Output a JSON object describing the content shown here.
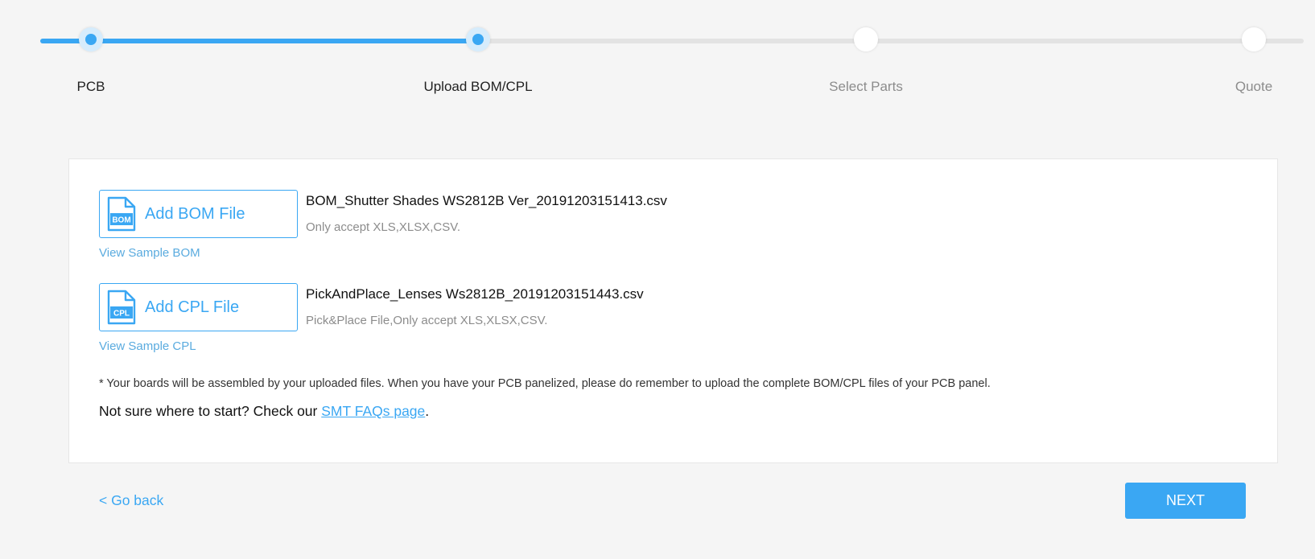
{
  "stepper": {
    "steps": [
      {
        "label": "PCB",
        "status": "done"
      },
      {
        "label": "Upload BOM/CPL",
        "status": "current"
      },
      {
        "label": "Select Parts",
        "status": "pending"
      },
      {
        "label": "Quote",
        "status": "pending"
      }
    ]
  },
  "bom": {
    "button_label": "Add BOM File",
    "icon_text": "BOM",
    "file_name": "BOM_Shutter Shades WS2812B Ver_20191203151413.csv",
    "hint": "Only accept XLS,XLSX,CSV.",
    "sample_link": "View Sample BOM"
  },
  "cpl": {
    "button_label": "Add CPL File",
    "icon_text": "CPL",
    "file_name": "PickAndPlace_Lenses Ws2812B_20191203151443.csv",
    "hint": "Pick&Place File,Only accept XLS,XLSX,CSV.",
    "sample_link": "View Sample CPL"
  },
  "note": "* Your boards will be assembled by your uploaded files. When you have your PCB panelized, please do remember to upload the complete BOM/CPL files of your PCB panel.",
  "help": {
    "prefix": "Not sure where to start? Check our ",
    "link": "SMT FAQs page",
    "suffix": "."
  },
  "footer": {
    "back_label": "< Go back",
    "next_label": "NEXT"
  },
  "colors": {
    "accent": "#3aa7f3",
    "track": "#e3e3e3",
    "muted_text": "#8c8c8c"
  }
}
